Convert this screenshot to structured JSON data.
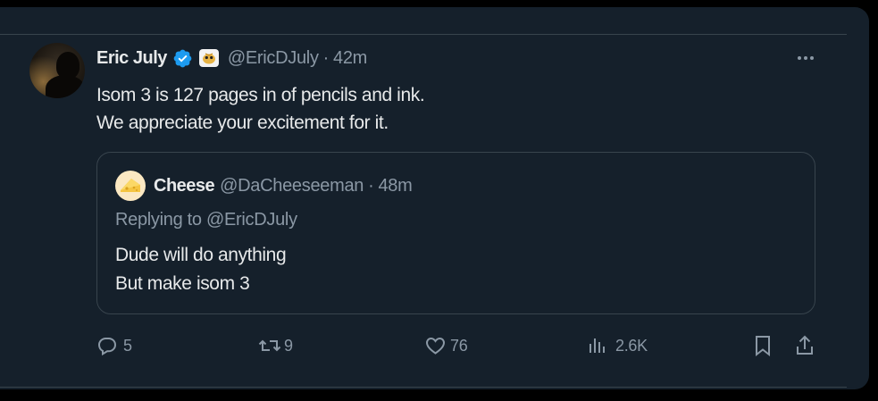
{
  "tweet": {
    "author_name": "Eric July",
    "author_handle": "@EricDJuly",
    "separator": "·",
    "time": "42m",
    "body_lines": [
      "Isom 3 is 127 pages in of pencils and ink.",
      "We appreciate your excitement for it."
    ],
    "more_icon": "more-horizontal-icon"
  },
  "quote": {
    "author_name": "Cheese",
    "author_handle": "@DaCheeseeman",
    "separator": "·",
    "time": "48m",
    "replying_to": "Replying to @EricDJuly",
    "body_lines": [
      "Dude will do anything",
      "But make isom 3"
    ]
  },
  "actions": {
    "replies": "5",
    "retweets": "9",
    "likes": "76",
    "views": "2.6K"
  },
  "colors": {
    "background": "#15202b",
    "text": "#e7e9ea",
    "secondary_text": "#8b98a5",
    "border": "#38444d",
    "verified_blue": "#1d9bf0"
  }
}
